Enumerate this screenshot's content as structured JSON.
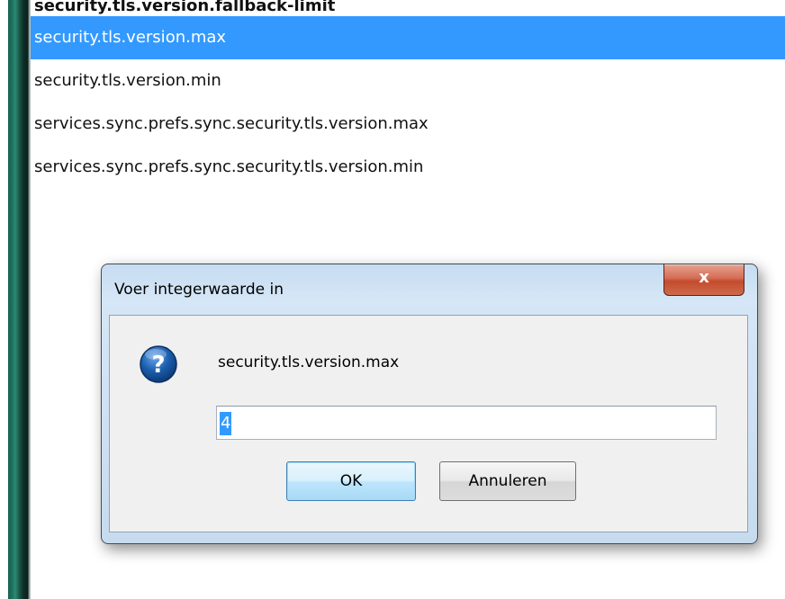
{
  "preferences": {
    "rows": [
      "security.tls.version.fallback-limit",
      "security.tls.version.max",
      "security.tls.version.min",
      "services.sync.prefs.sync.security.tls.version.max",
      "services.sync.prefs.sync.security.tls.version.min"
    ]
  },
  "dialog": {
    "title": "Voer integerwaarde in",
    "close_label": "x",
    "icon": "question-icon",
    "message": "security.tls.version.max",
    "input_value": "4",
    "ok_label": "OK",
    "cancel_label": "Annuleren"
  },
  "colors": {
    "selection": "#3399ff",
    "close_button": "#c44b2d",
    "question_icon": "#1b5fae"
  }
}
